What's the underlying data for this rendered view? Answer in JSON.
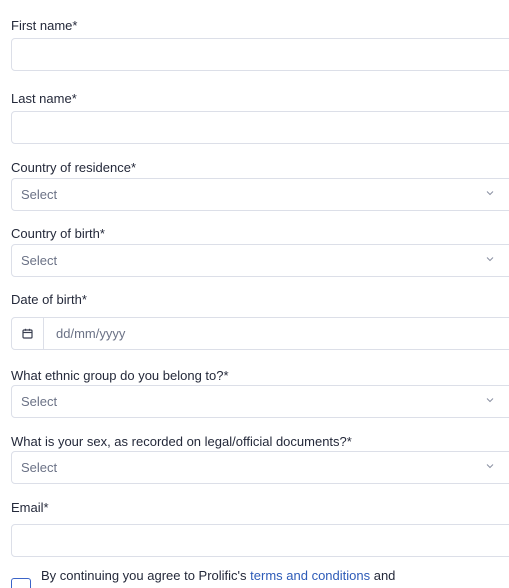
{
  "form": {
    "first_name": {
      "label": "First name*",
      "value": ""
    },
    "last_name": {
      "label": "Last name*",
      "value": ""
    },
    "country_residence": {
      "label": "Country of residence*",
      "value": "Select"
    },
    "country_birth": {
      "label": "Country of birth*",
      "value": "Select"
    },
    "date_of_birth": {
      "label": "Date of birth*",
      "placeholder": "dd/mm/yyyy"
    },
    "ethnic_group": {
      "label": "What ethnic group do you belong to?*",
      "value": "Select"
    },
    "sex": {
      "label": "What is your sex, as recorded on legal/official documents?*",
      "value": "Select"
    },
    "email": {
      "label": "Email*",
      "value": ""
    }
  },
  "terms": {
    "prefix": "By continuing you agree to Prolific's ",
    "link": "terms and conditions",
    "suffix": " and"
  },
  "icons": {
    "calendar": "calendar-icon",
    "chevron": "chevron-down-icon"
  },
  "colors": {
    "accent": "#2d5bb8",
    "border": "#dcdfe8"
  }
}
